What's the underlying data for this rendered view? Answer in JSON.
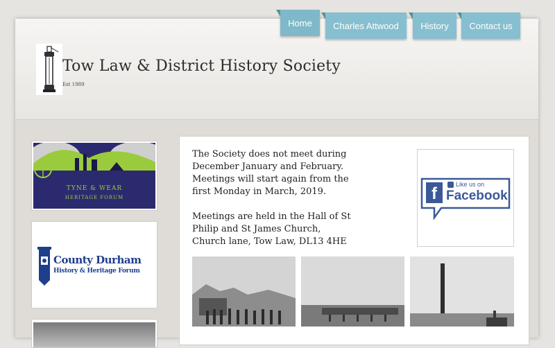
{
  "nav": {
    "items": [
      {
        "label": "Home"
      },
      {
        "label": "Charles Attwood"
      },
      {
        "label": "History"
      },
      {
        "label": "Contact us"
      }
    ]
  },
  "header": {
    "title": "Tow Law & District History Society",
    "tagline": "Est 1989"
  },
  "sidebar": {
    "tyne_wear": {
      "line1": "TYNE & WEAR",
      "line2": "HERITAGE FORUM"
    },
    "county_durham": {
      "line1": "County Durham",
      "line2": "History & Heritage Forum"
    }
  },
  "main": {
    "notice_paragraphs": [
      "The Society does not meet during December January and February. Meetings will start again from the first Monday in March, 2019.",
      "Meetings are held in the Hall of St Philip and St James Church, Church lane, Tow Law, DL13 4HE"
    ],
    "facebook": {
      "like_text": "Like us on",
      "brand": "Facebook"
    }
  },
  "colors": {
    "nav_tab": "#86bfcf",
    "forum_purple": "#2c2a6e",
    "forum_green": "#9acb3c",
    "durham_blue": "#1f3e8c",
    "facebook_blue": "#3b5998"
  }
}
